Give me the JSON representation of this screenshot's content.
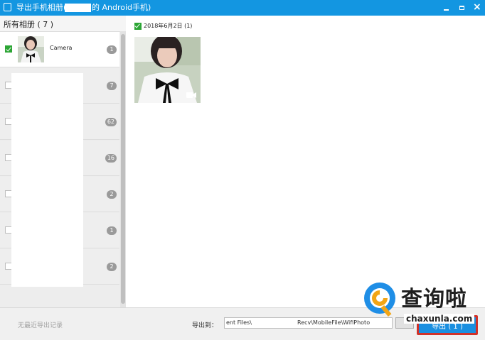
{
  "window": {
    "title_prefix": "导出手机相册(",
    "title_suffix": "的 Android手机)",
    "controls": {
      "close_glyph": "×"
    }
  },
  "left_panel": {
    "header": "所有相册 ( 7 )",
    "albums": [
      {
        "name": "Camera",
        "count": "1",
        "checked": true
      },
      {
        "name": "",
        "count": "7",
        "checked": false
      },
      {
        "name": "",
        "count": "62",
        "checked": false
      },
      {
        "name": "",
        "count": "16",
        "checked": false
      },
      {
        "name": "",
        "count": "2",
        "checked": false
      },
      {
        "name": "",
        "count": "1",
        "checked": false
      },
      {
        "name": "",
        "count": "2",
        "checked": false
      }
    ]
  },
  "right_panel": {
    "date_group_label": "2018年6月2日 (1)"
  },
  "footer": {
    "no_record": "无最近导出记录",
    "export_to_label": "导出到：",
    "path_part1": "ent Files\\",
    "path_part2": "Recv\\MobileFile\\WifiPhoto",
    "export_button": "导出 ( 1 )"
  },
  "watermark": {
    "text": "查询啦",
    "sub": "chaxunla.com"
  },
  "colors": {
    "accent": "#1396e1",
    "check_green": "#2ca535",
    "export_border": "#d0322a"
  }
}
